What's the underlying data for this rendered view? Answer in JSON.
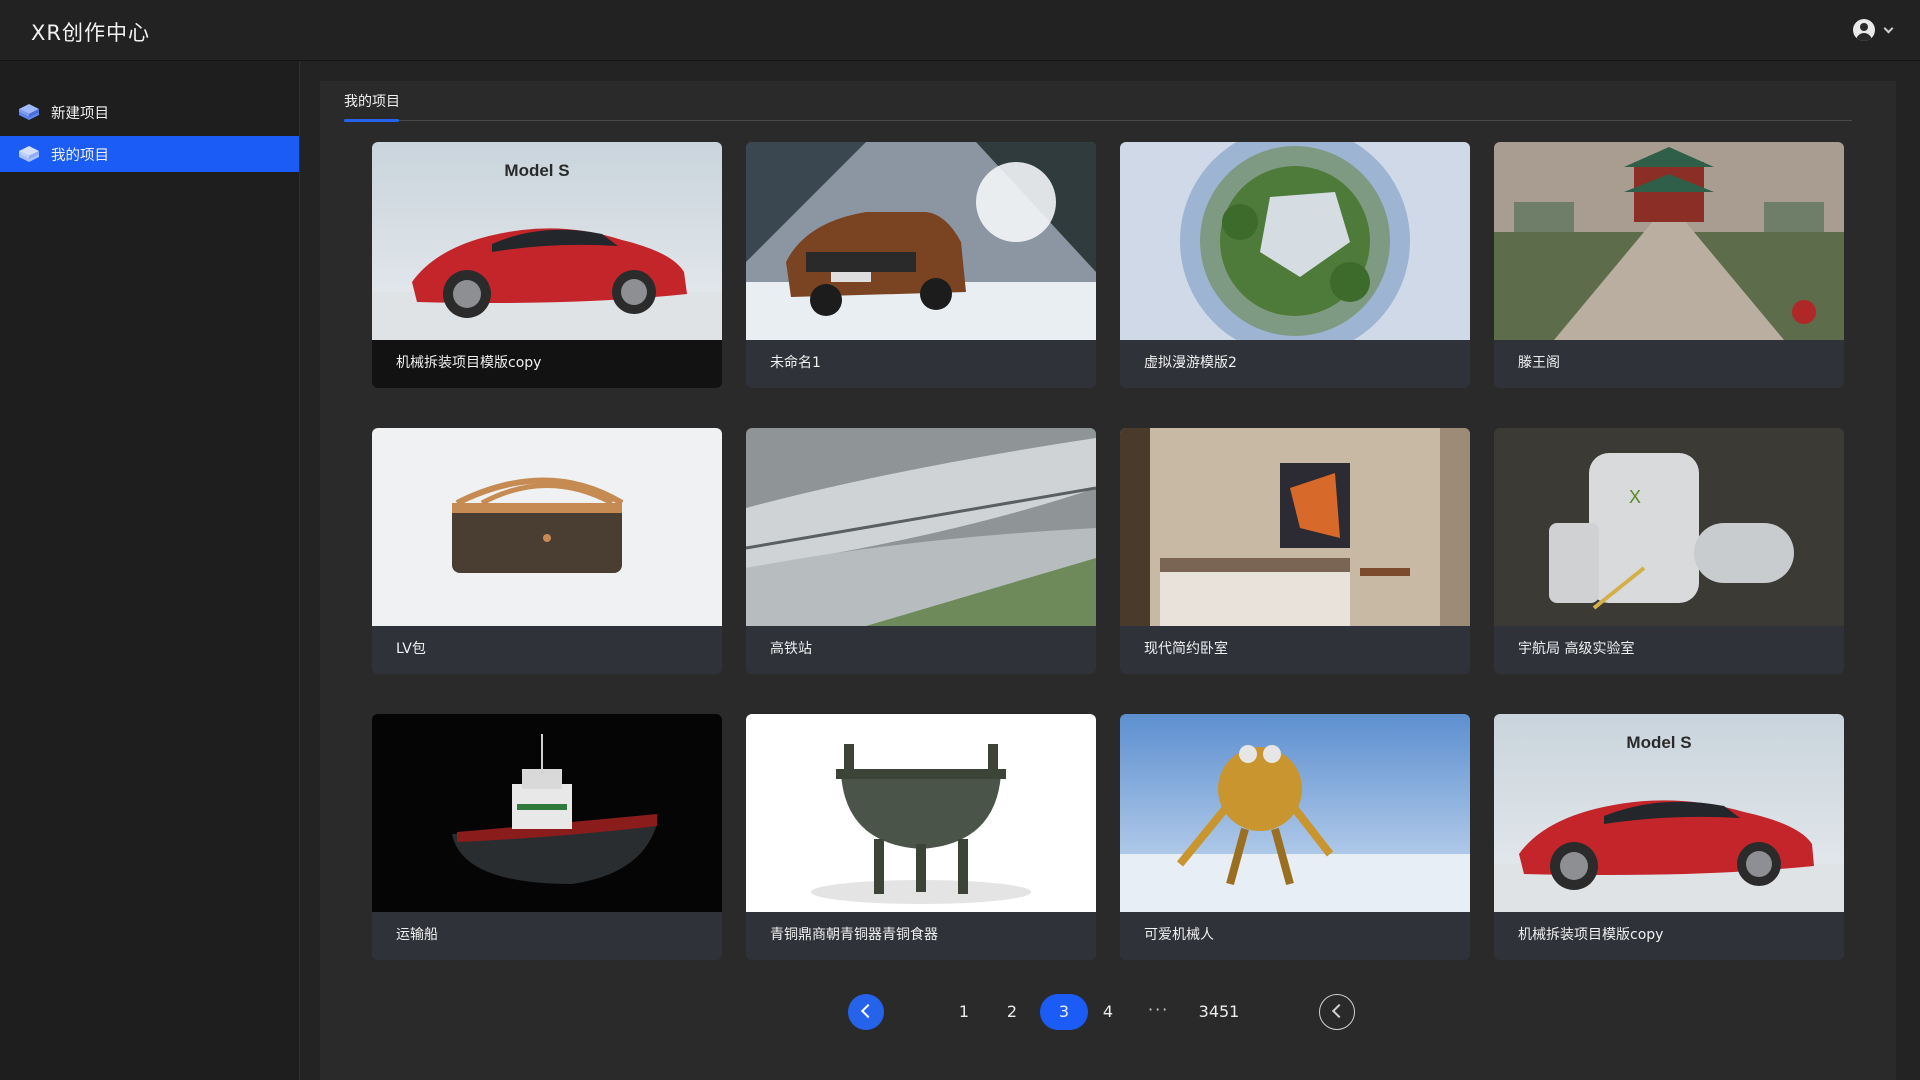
{
  "header": {
    "app_title": "XR创作中心",
    "user_icon": "user-avatar-icon",
    "menu_icon": "chevron-down-icon"
  },
  "sidebar": {
    "items": [
      {
        "label": "新建项目",
        "icon": "cube-layers-icon",
        "active": false
      },
      {
        "label": "我的项目",
        "icon": "cube-layers-icon",
        "active": true
      }
    ]
  },
  "main": {
    "tabs": [
      {
        "label": "我的项目",
        "active": true
      }
    ],
    "projects": [
      {
        "title": "机械拆装项目模版copy",
        "thumb": "red-sedan",
        "label_on_thumb": "Model S"
      },
      {
        "title": "未命名1",
        "thumb": "suv-snow"
      },
      {
        "title": "虚拟漫游模版2",
        "thumb": "tiny-planet"
      },
      {
        "title": "滕王阁",
        "thumb": "pavilion"
      },
      {
        "title": "LV包",
        "thumb": "handbag"
      },
      {
        "title": "高铁站",
        "thumb": "station"
      },
      {
        "title": "现代简约卧室",
        "thumb": "bedroom"
      },
      {
        "title": "宇航局 高级实验室",
        "thumb": "space-module"
      },
      {
        "title": "运输船",
        "thumb": "tugboat"
      },
      {
        "title": "青铜鼎商朝青铜器青铜食器",
        "thumb": "bronze-ding"
      },
      {
        "title": "可爱机械人",
        "thumb": "robot"
      },
      {
        "title": "机械拆装项目模版copy",
        "thumb": "red-sedan",
        "label_on_thumb": "Model S"
      }
    ]
  },
  "pagination": {
    "pages": [
      "1",
      "2",
      "3",
      "4"
    ],
    "current": "3",
    "ellipsis": "···",
    "last": "3451",
    "prev_icon": "chevron-left-icon",
    "next_icon": "chevron-left-icon"
  },
  "colors": {
    "accent": "#1a5cf5",
    "card_bg": "#2f3239",
    "page_bg": "#2a2a2a",
    "sidebar_bg": "#1e1e1e"
  }
}
